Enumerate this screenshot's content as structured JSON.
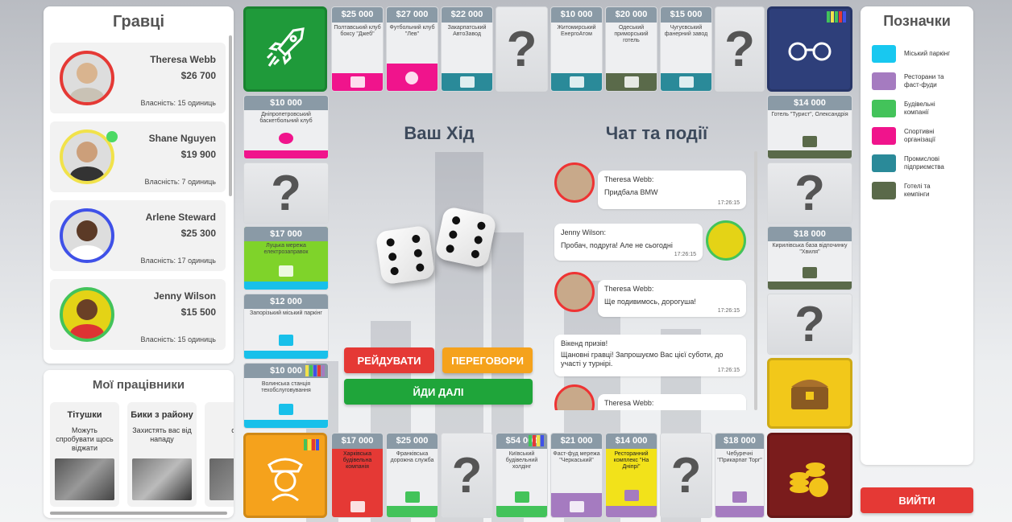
{
  "players_panel": {
    "title": "Гравці",
    "players": [
      {
        "name": "Theresa Webb",
        "money": "$26 700",
        "property": "Власність: 15 одиниць",
        "color": "#e53935"
      },
      {
        "name": "Shane Nguyen",
        "money": "$19 900",
        "property": "Власність: 7 одиниць",
        "color": "#f1e24a"
      },
      {
        "name": "Arlene Steward",
        "money": "$25 300",
        "property": "Власність: 17 одиниць",
        "color": "#3f51e8"
      },
      {
        "name": "Jenny Wilson",
        "money": "$15 500",
        "property": "Власність: 15 одиниць",
        "color": "#43c35a"
      }
    ]
  },
  "workers_panel": {
    "title": "Мої працівники",
    "workers": [
      {
        "title": "Тітушки",
        "desc": "Можуть спробувати щось віджати"
      },
      {
        "title": "Бики з району",
        "desc": "Захистять вас від нападу"
      },
      {
        "title": "Т",
        "desc": "спро"
      }
    ]
  },
  "board": {
    "top": [
      {
        "price": "$25 000",
        "name": "Полтавський клуб боксу \"Джеб\"",
        "color": "#f0148c"
      },
      {
        "price": "$27 000",
        "name": "Футбольний клуб \"Лев\"",
        "color": "#f0148c"
      },
      {
        "price": "$22 000",
        "name": "Закарпатський АвтоЗавод",
        "color": "#2a8a99"
      },
      {
        "price": "$10 000",
        "name": "Житомирський ЕнергоАтом",
        "color": "#2a8a99"
      },
      {
        "price": "$20 000",
        "name": "Одеський приморський готель",
        "color": "#5a6a4a"
      },
      {
        "price": "$15 000",
        "name": "Чугуєвський фанерний завод",
        "color": "#2a8a99"
      }
    ],
    "left": [
      {
        "price": "$10 000",
        "name": "Дніпропетровський баскетбольний клуб",
        "color": "#f0148c"
      },
      {
        "price": "$17 000",
        "name": "Луцька мережа електрозаправок",
        "color": "#18c0ea"
      },
      {
        "price": "$12 000",
        "name": "Запорізький міський паркінг",
        "color": "#18c0ea"
      },
      {
        "price": "$10 000",
        "name": "Волинська станція техобслуговування",
        "color": "#18c0ea"
      }
    ],
    "right": [
      {
        "price": "$14 000",
        "name": "Готель \"Турист\", Олександрія",
        "color": "#5a6a4a"
      },
      {
        "price": "$18 000",
        "name": "Кирилівська база відпочинку \"Хвиля\"",
        "color": "#5a6a4a"
      }
    ],
    "bottom": [
      {
        "price": "$17 000",
        "name": "Харківська будівельна компанія",
        "color": "#43c35a"
      },
      {
        "price": "$25 000",
        "name": "Франківська дорожна служба",
        "color": "#43c35a"
      },
      {
        "price": "$54 000",
        "name": "Київський будівельний холдінг",
        "color": "#43c35a"
      },
      {
        "price": "$21 000",
        "name": "Фаст-фуд мережа \"Черкаський\"",
        "color": "#a57bc0"
      },
      {
        "price": "$14 000",
        "name": "Ресторанний комплекс \"На Дніпрі\"",
        "color": "#a57bc0"
      },
      {
        "price": "$18 000",
        "name": "Чебуречні \"Прикарпат Торг\"",
        "color": "#a57bc0"
      }
    ],
    "question": "?"
  },
  "center": {
    "your_turn": "Ваш Хід",
    "chat_title": "Чат та події",
    "buttons": {
      "raid": "РЕЙДУВАТИ",
      "negotiate": "ПЕРЕГОВОРИ",
      "next": "ЙДИ ДАЛІ"
    },
    "messages": [
      {
        "author": "Theresa Webb:",
        "text": "Придбала BMW",
        "time": "17:26:15"
      },
      {
        "author": "Jenny Wilson:",
        "text": "Пробач, подруга! Але не сьогодні",
        "time": "17:26:15"
      },
      {
        "author": "Theresa Webb:",
        "text": "Ще подивимось, дорогуша!",
        "time": "17:26:15"
      },
      {
        "author": "Вікенд призів!",
        "text": "Щановні гравці! Запрошуємо Вас цієї суботи, до участі у турнірі.",
        "time": "17:26:15"
      },
      {
        "author": "Theresa Webb:",
        "text": "",
        "time": ""
      }
    ]
  },
  "legend": {
    "title": "Позначки",
    "items": [
      {
        "label": "Міський паркінг",
        "color": "#18c8f0"
      },
      {
        "label": "Ресторани та фаст-фуди",
        "color": "#a57bc0"
      },
      {
        "label": "Будівельні компанії",
        "color": "#43c35a"
      },
      {
        "label": "Спортивні організації",
        "color": "#f0148c"
      },
      {
        "label": "Промислові підприємства",
        "color": "#2a8a99"
      },
      {
        "label": "Готелі та кемпінги",
        "color": "#5a6a4a"
      }
    ],
    "exit": "ВИЙТИ"
  }
}
